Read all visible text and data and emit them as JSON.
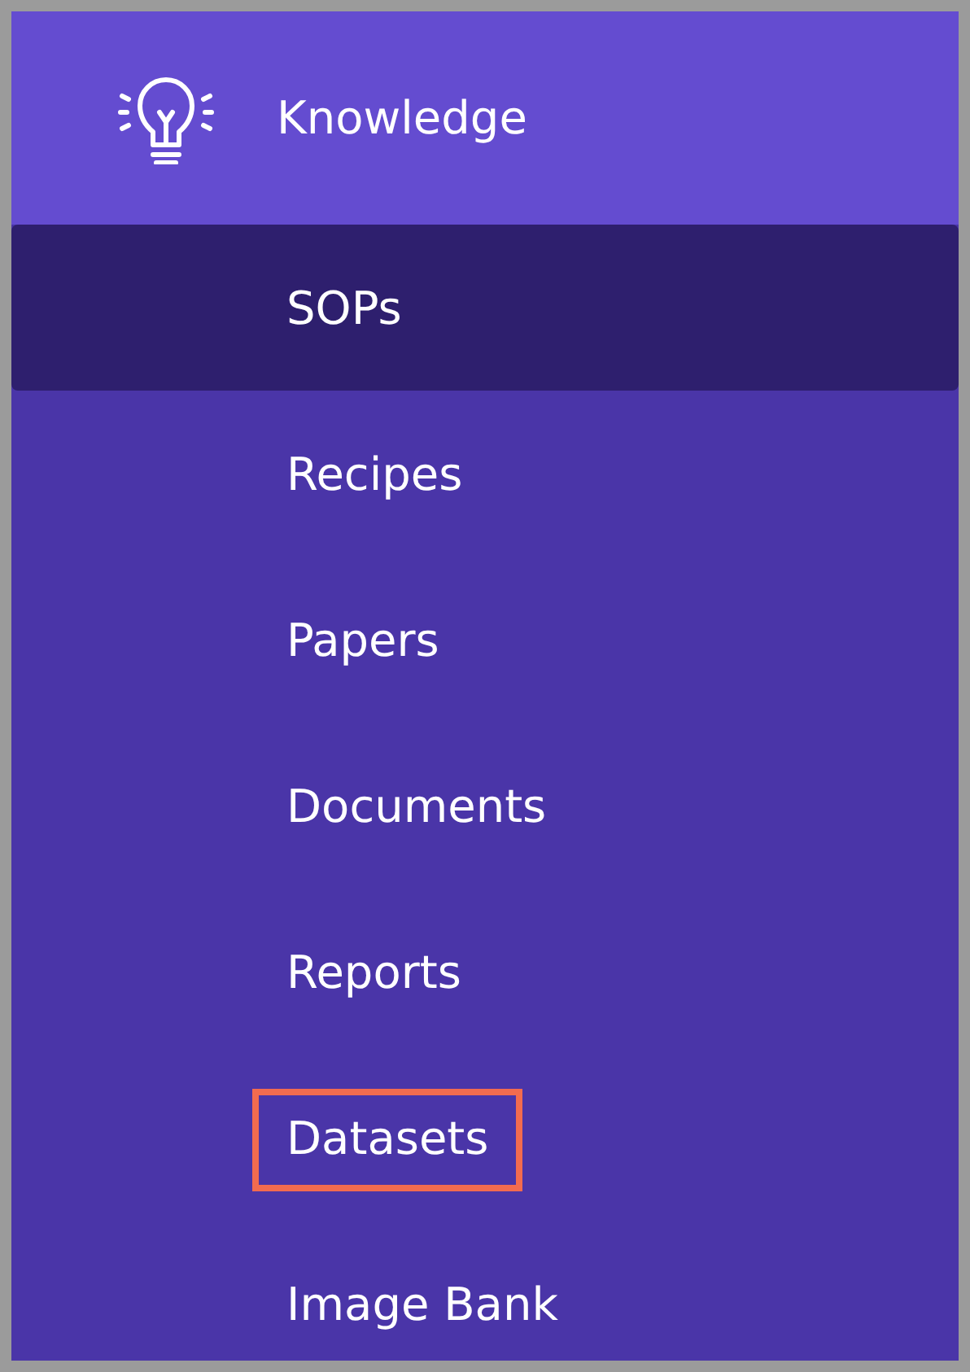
{
  "section": {
    "title": "Knowledge"
  },
  "items": [
    {
      "label": "SOPs",
      "selected": true,
      "highlighted": false
    },
    {
      "label": "Recipes",
      "selected": false,
      "highlighted": false
    },
    {
      "label": "Papers",
      "selected": false,
      "highlighted": false
    },
    {
      "label": "Documents",
      "selected": false,
      "highlighted": false
    },
    {
      "label": "Reports",
      "selected": false,
      "highlighted": false
    },
    {
      "label": "Datasets",
      "selected": false,
      "highlighted": true
    },
    {
      "label": "Image Bank",
      "selected": false,
      "highlighted": false
    }
  ]
}
